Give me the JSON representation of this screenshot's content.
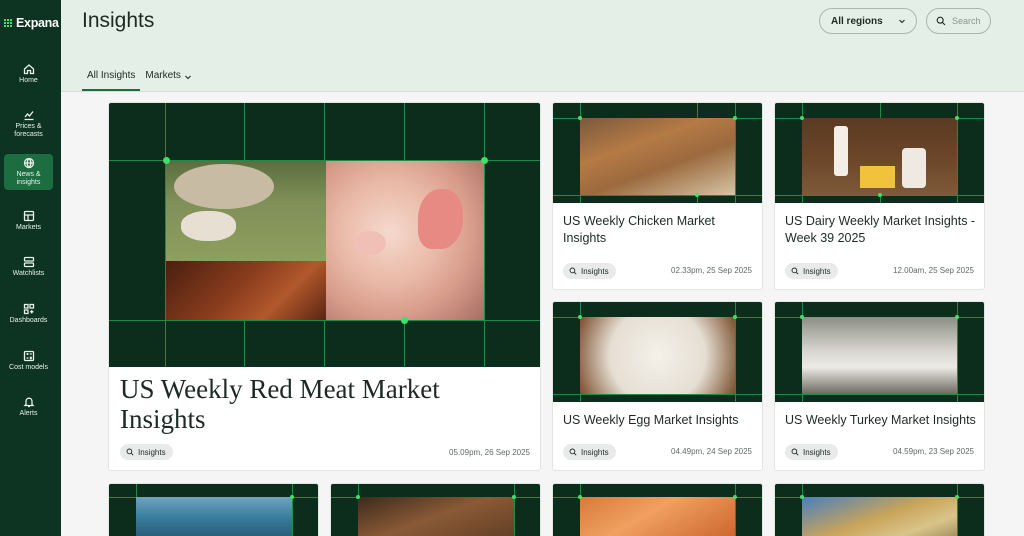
{
  "brand": {
    "name": "Expana",
    "accent": "#3ee06a",
    "sidebar_bg": "#0d3322",
    "active_bg": "#1c6d40"
  },
  "sidebar": {
    "items": [
      {
        "label": "Home",
        "icon": "home-icon"
      },
      {
        "label": "Prices & forecasts",
        "icon": "chart-icon"
      },
      {
        "label": "News & insights",
        "icon": "globe-icon",
        "active": true
      },
      {
        "label": "Markets",
        "icon": "markets-icon"
      },
      {
        "label": "Watchlists",
        "icon": "watchlist-icon"
      },
      {
        "label": "Dashboards",
        "icon": "dashboard-icon"
      },
      {
        "label": "Cost models",
        "icon": "calculator-icon"
      },
      {
        "label": "Alerts",
        "icon": "bell-icon"
      }
    ]
  },
  "header": {
    "title": "Insights",
    "region": "All regions",
    "search_placeholder": "Search",
    "tabs": [
      {
        "label": "All Insights",
        "active": true
      },
      {
        "label": "Markets",
        "dropdown": true
      }
    ]
  },
  "cards": [
    {
      "title": "US Weekly Red Meat Market Insights",
      "tag": "Insights",
      "date": "05.09pm, 26 Sep 2025",
      "image": "red-meat-collage"
    },
    {
      "title": "US Weekly Chicken Market Insights",
      "tag": "Insights",
      "date": "02.33pm, 25 Sep 2025",
      "image": "chickens"
    },
    {
      "title": "US Dairy Weekly Market Insights - Week 39 2025",
      "tag": "Insights",
      "date": "12.00am, 25 Sep 2025",
      "image": "dairy"
    },
    {
      "title": "US Weekly Egg Market Insights",
      "tag": "Insights",
      "date": "04.49pm, 24 Sep 2025",
      "image": "eggs"
    },
    {
      "title": "US Weekly Turkey Market Insights",
      "tag": "Insights",
      "date": "04.59pm, 23 Sep 2025",
      "image": "turkeys"
    }
  ]
}
